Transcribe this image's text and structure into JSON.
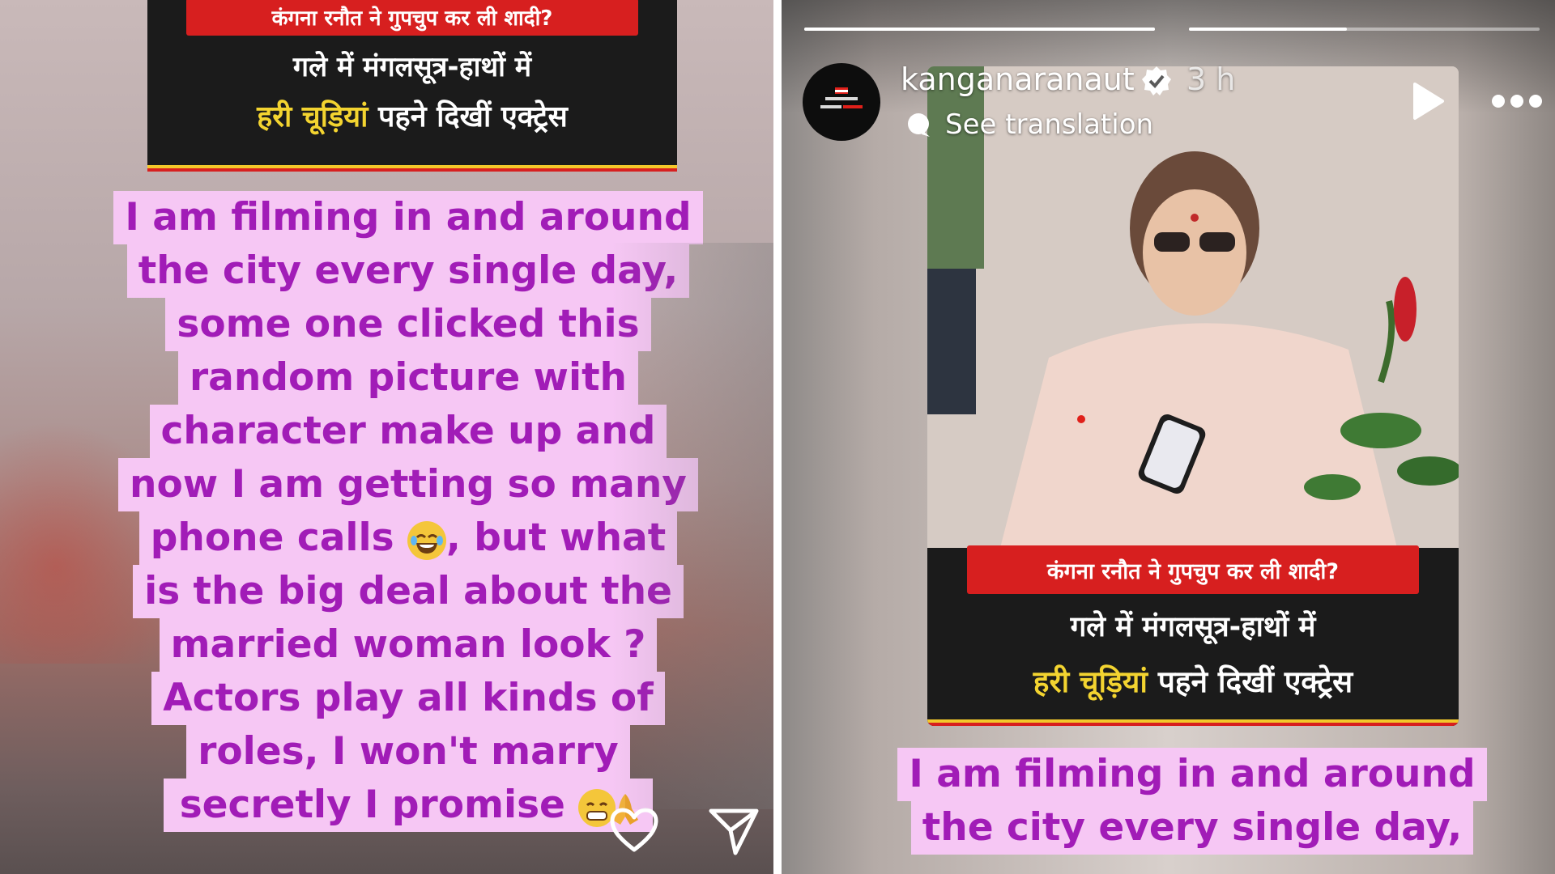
{
  "news_card": {
    "banner": "कंगना रनौत ने गुपचुप कर ली शादी?",
    "line1": "गले में मंगलसूत्र-हाथों में",
    "line2_highlight": "हरी चूड़ियां",
    "line2_rest": " पहने दिखीं एक्ट्रेस"
  },
  "left_story": {
    "caption_lines": [
      "I am filming in and around",
      "the city every single day,",
      "some one clicked this",
      "random picture with",
      "character make up and",
      "now I am getting so many",
      "phone calls",
      ", but what",
      "is the big deal about the",
      "married woman look ?",
      "Actors play all kinds of",
      "roles, I won't marry",
      "secretly I promise"
    ]
  },
  "right_story": {
    "username": "kanganaranaut",
    "timestamp": "3 h",
    "translation_label": "See translation",
    "progress": [
      1.0,
      0.45
    ],
    "caption_lines": [
      "I am filming in and around",
      "the city every single day,"
    ]
  },
  "colors": {
    "caption_bg": "#f6c7f4",
    "caption_text": "#a11cb7",
    "banner_red": "#d71f1f",
    "highlight_yellow": "#f3d430"
  },
  "icons": [
    "heart-icon",
    "send-icon",
    "verified-icon",
    "translation-icon",
    "play-icon",
    "more-icon",
    "laughing-emoji-icon",
    "grin-emoji-icon",
    "folded-hands-emoji-icon"
  ]
}
